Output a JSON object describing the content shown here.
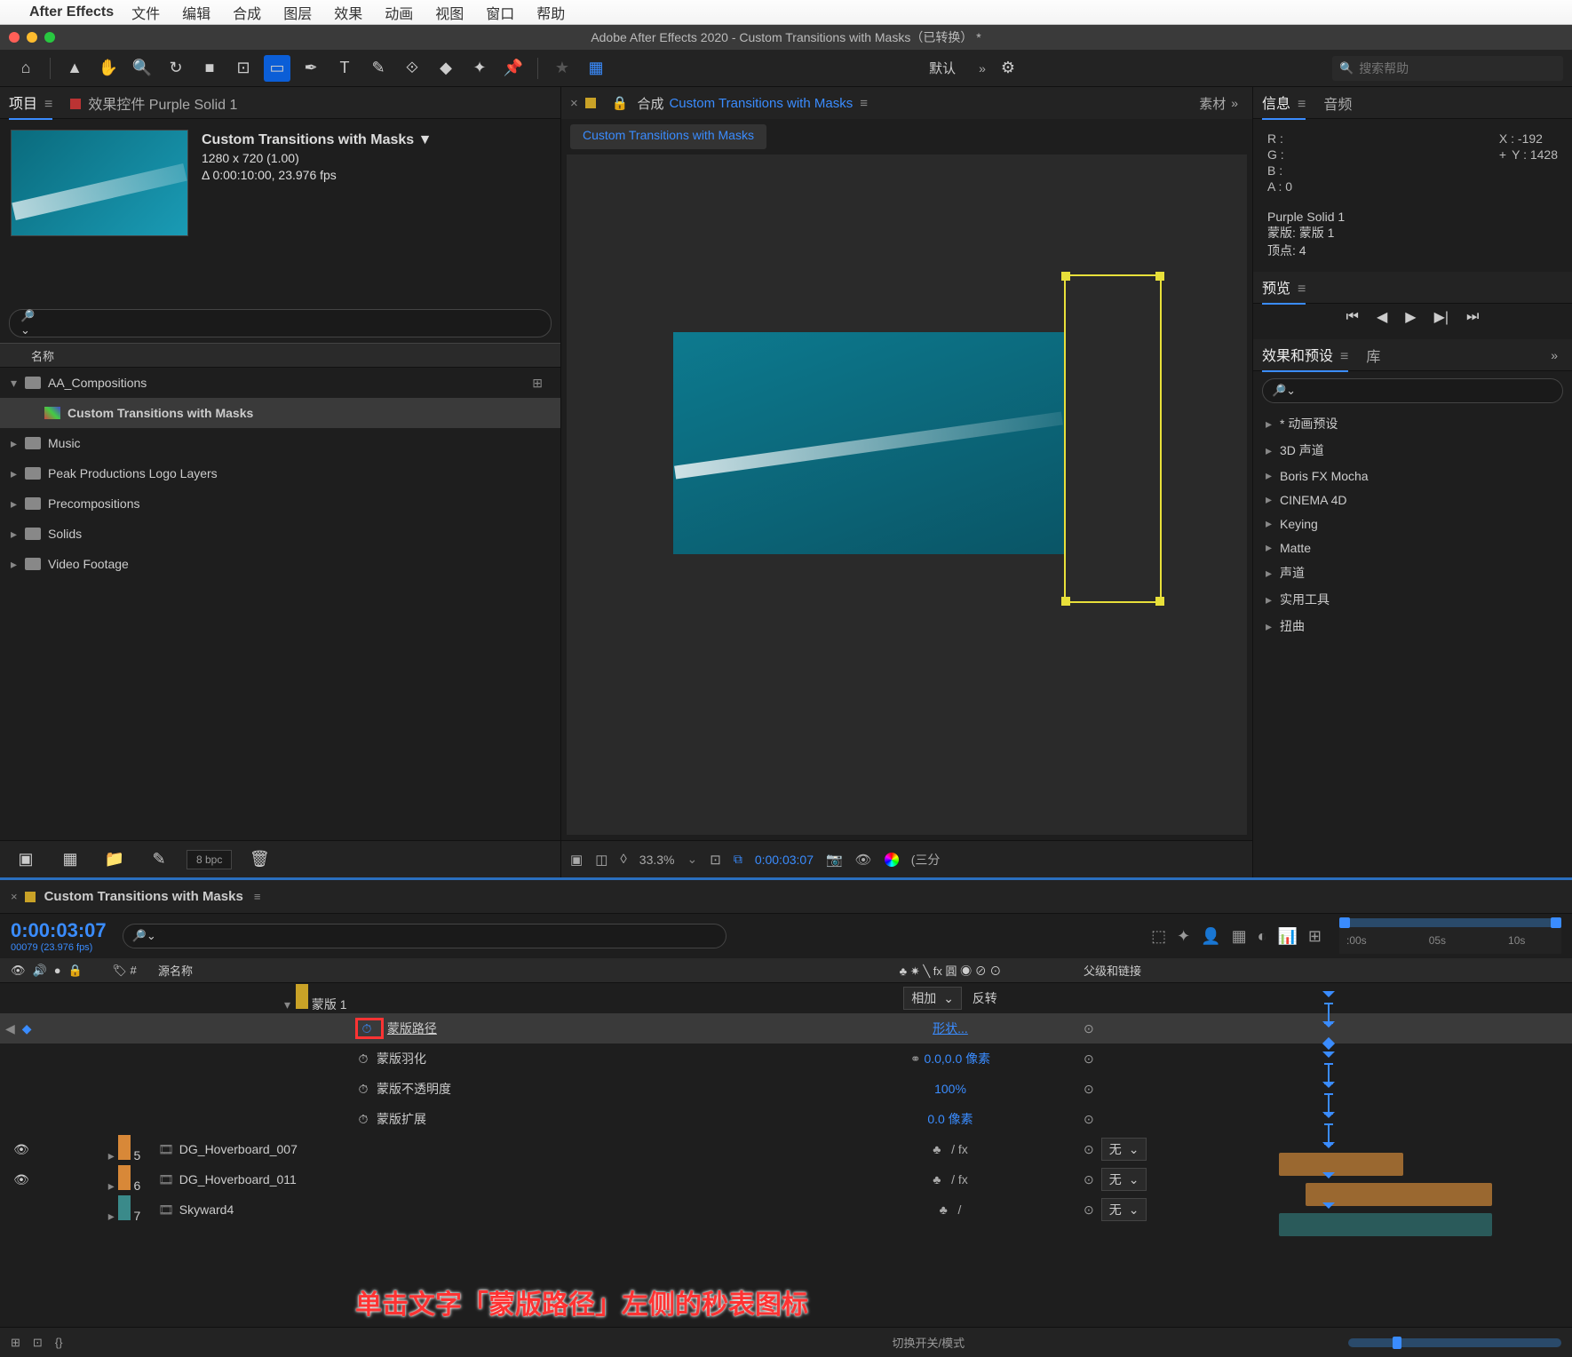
{
  "menubar": {
    "appname": "After Effects",
    "items": [
      "文件",
      "编辑",
      "合成",
      "图层",
      "效果",
      "动画",
      "视图",
      "窗口",
      "帮助"
    ]
  },
  "window": {
    "title": "Adobe After Effects 2020 - Custom Transitions with Masks（已转换） *"
  },
  "toolbar": {
    "workspace": "默认",
    "search_placeholder": "搜索帮助"
  },
  "project_panel": {
    "tab_project": "项目",
    "tab_effects": "效果控件 Purple Solid 1",
    "comp_name": "Custom Transitions with Masks ▼",
    "dimensions": "1280 x 720 (1.00)",
    "duration": "Δ 0:00:10:00, 23.976 fps",
    "header_name": "名称",
    "folders": {
      "aa": "AA_Compositions",
      "comp": "Custom Transitions with Masks",
      "music": "Music",
      "peak": "Peak Productions Logo Layers",
      "precomp": "Precompositions",
      "solids": "Solids",
      "video": "Video Footage"
    },
    "bpc": "8 bpc"
  },
  "viewer": {
    "tab_label": "合成",
    "tab_compname": "Custom Transitions with Masks",
    "breadcrumb": "Custom Transitions with Masks",
    "right_tab": "素材",
    "zoom": "33.3%",
    "timecode": "0:00:03:07",
    "quality": "(三分"
  },
  "info": {
    "tab_info": "信息",
    "tab_audio": "音频",
    "r": "R :",
    "g": "G :",
    "b": "B :",
    "a": "A :   0",
    "x": "X : -192",
    "y": "Y :  1428",
    "selection_layer": "Purple Solid 1",
    "selection_mask": "蒙版: 蒙版 1",
    "selection_vertex": "  顶点: 4"
  },
  "preview": {
    "tab": "预览"
  },
  "effects": {
    "tab_effects": "效果和预设",
    "tab_lib": "库",
    "items": [
      "* 动画预设",
      "3D 声道",
      "Boris FX Mocha",
      "CINEMA 4D",
      "Keying",
      "Matte",
      "声道",
      "实用工具",
      "扭曲"
    ]
  },
  "timeline": {
    "tab_name": "Custom Transitions with Masks",
    "timecode": "0:00:03:07",
    "frames": "00079 (23.976 fps)",
    "ruler": [
      ":00s",
      "05s",
      "10s"
    ],
    "header": {
      "num": "#",
      "source": "源名称",
      "switches": "♣ ✷ ╲ fx 圓 ◉ ⊘ ⊙",
      "parent": "父级和链接"
    },
    "mask_group": "蒙版 1",
    "mask_mode": "相加",
    "mask_invert": "反转",
    "props": {
      "path": "蒙版路径",
      "path_val": "形状...",
      "feather": "蒙版羽化",
      "feather_val": "0.0,0.0 像素",
      "opacity": "蒙版不透明度",
      "opacity_val": "100%",
      "expansion": "蒙版扩展",
      "expansion_val": "0.0 像素"
    },
    "layers": [
      {
        "idx": "5",
        "name": "DG_Hoverboard_007",
        "parent": "无",
        "swatch": "sw-orange"
      },
      {
        "idx": "6",
        "name": "DG_Hoverboard_011",
        "parent": "无",
        "swatch": "sw-orange"
      },
      {
        "idx": "7",
        "name": "Skyward4",
        "parent": "无",
        "swatch": "sw-teal"
      }
    ],
    "switches_label": "切换开关/模式"
  },
  "annotation": "单击文字「蒙版路径」左侧的秒表图标"
}
